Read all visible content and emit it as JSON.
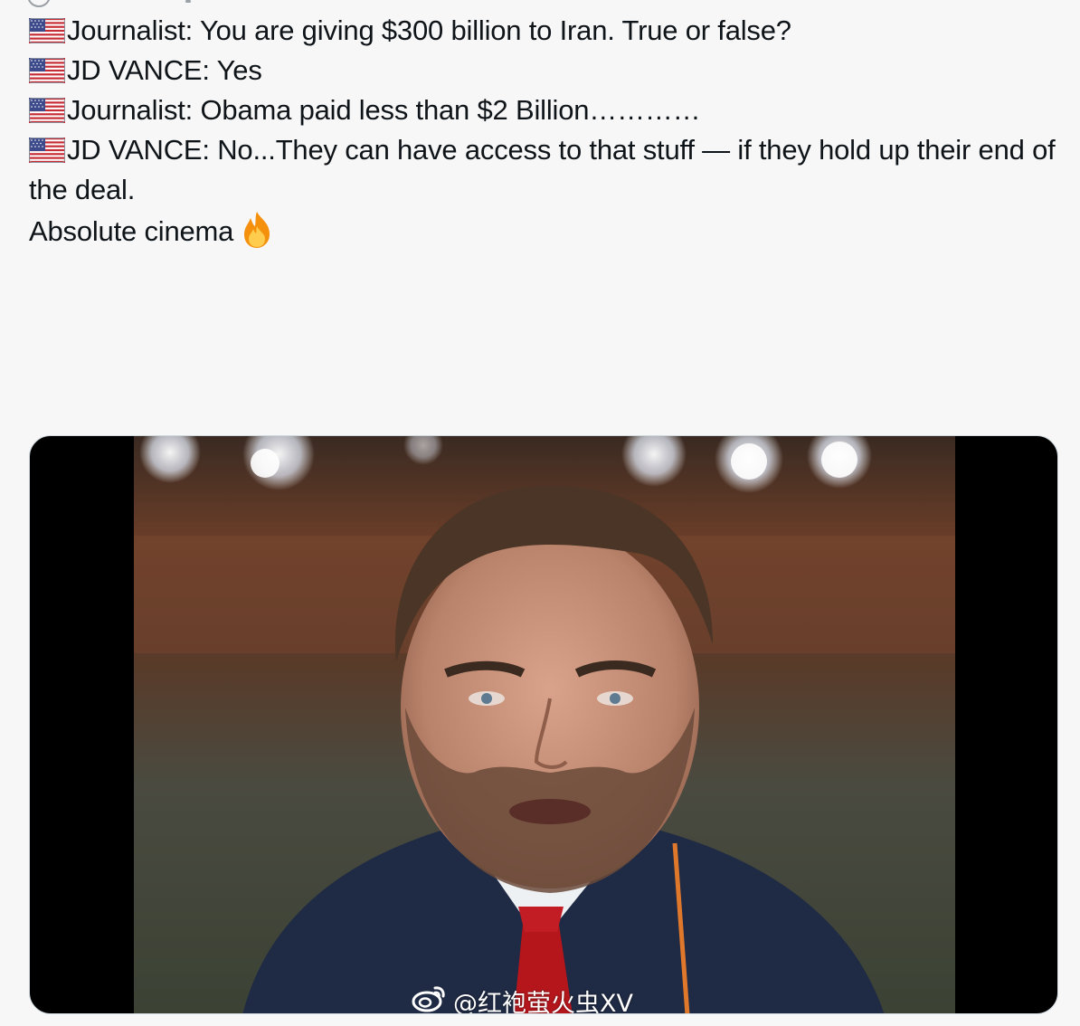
{
  "post": {
    "lines": [
      {
        "flag": "us-flag-icon",
        "text": "Journalist: You are giving $300 billion to Iran. True or false?"
      },
      {
        "flag": "us-flag-icon",
        "text": "JD VANCE: Yes"
      },
      {
        "flag": "us-flag-icon",
        "text": "Journalist: Obama paid less than $2 Billion…………"
      },
      {
        "flag": "us-flag-icon",
        "text": "JD VANCE: No...They can have access to that stuff — if they hold up their end of the deal."
      }
    ],
    "closing": "Absolute cinema",
    "closing_icon": "fire-icon"
  },
  "media": {
    "watermark": "@红袍萤火虫XV",
    "watermark_icon": "weibo-icon"
  },
  "colors": {
    "background": "#f7f7f7",
    "text": "#0f1419",
    "media_border": "#cfd9de",
    "tie": "#b5161c",
    "suit": "#1f2a44"
  }
}
